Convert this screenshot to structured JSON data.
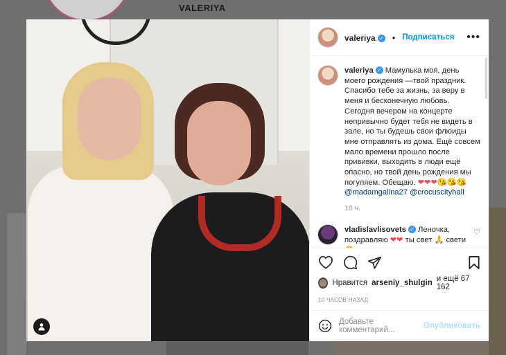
{
  "background": {
    "username": "VALERIYA"
  },
  "post": {
    "header": {
      "username": "valeriya",
      "follow_label": "Подписаться",
      "more_label": "•••"
    },
    "caption": {
      "username": "valeriya",
      "text": "Мамулька моя, день моего рождения —твой праздник. Спасибо тебе за жизнь, за веру в меня и бесконечную любовь. Сегодня вечером на концерте непривычно будет тебя не видеть в зале, но ты будешь свои флюиды мне отправлять из дома. Ещё совсем мало времени прошло после прививки, выходить в люди ещё опасно, но твой день рождения мы погуляем. Обещаю.",
      "emojis": "❤❤❤😘😘😘",
      "mention1": "@madamgalina27",
      "mention2": "@crocuscityhall",
      "time": "10 ч."
    },
    "comment": {
      "username": "vladislavlisovets",
      "text": "Леночка, поздравляю",
      "hearts": "❤❤",
      "text2": "ты свет",
      "emoji1": "🙏",
      "text3": "свети",
      "emoji2": "😍"
    },
    "likes": {
      "prefix": "Нравится",
      "user": "arseniy_shulgin",
      "suffix": "и ещё 67 162"
    },
    "posted_ago": "10 ЧАСОВ НАЗАД",
    "add_comment": {
      "placeholder": "Добавьте комментарий...",
      "publish_label": "Опубликовать"
    },
    "icons": {
      "like": "heart-icon",
      "comment": "comment-icon",
      "share": "share-icon",
      "save": "bookmark-icon",
      "emoji": "smiley-icon",
      "tag": "user-tag-icon"
    },
    "colors": {
      "link": "#0095f6",
      "mention": "#00376b",
      "heart": "#ed4956",
      "muted": "#8e8e8e"
    }
  }
}
